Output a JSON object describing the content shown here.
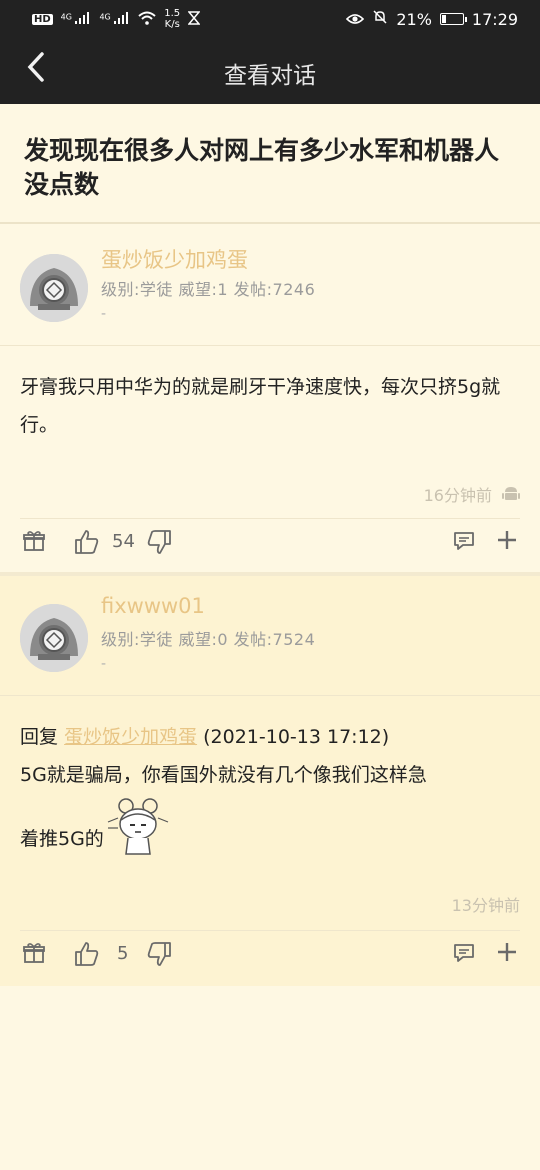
{
  "status_bar": {
    "hd_label": "HD",
    "net1": "4G",
    "net2": "4G",
    "speed_top": "1.5",
    "speed_unit": "K/s",
    "battery_percent": "21%",
    "battery_level": 0.21,
    "time": "17:29"
  },
  "nav": {
    "title": "查看对话"
  },
  "topic": {
    "title": "发现现在很多人对网上有多少水军和机器人没点数"
  },
  "posts": [
    {
      "username": "蛋炒饭少加鸡蛋",
      "meta": "级别:学徒 威望:1 发帖:7246",
      "dash": "-",
      "content": "牙膏我只用中华为的就是刷牙干净速度快，每次只挤5g就行。",
      "time": "16分钟前",
      "likes": "54"
    },
    {
      "username": "fixwww01",
      "meta": "级别:学徒 威望:0 发帖:7524",
      "dash": "-",
      "reply_prefix": "回复",
      "reply_user": "蛋炒饭少加鸡蛋",
      "reply_date": "(2021-10-13 17:12)",
      "content_line1": "5G就是骗局，你看国外就没有几个像我们这样急",
      "content_line2": "着推5G的",
      "time": "13分钟前",
      "likes": "5"
    }
  ],
  "colors": {
    "background": "#fef8e3",
    "header": "#222222",
    "username": "#e8c586"
  }
}
